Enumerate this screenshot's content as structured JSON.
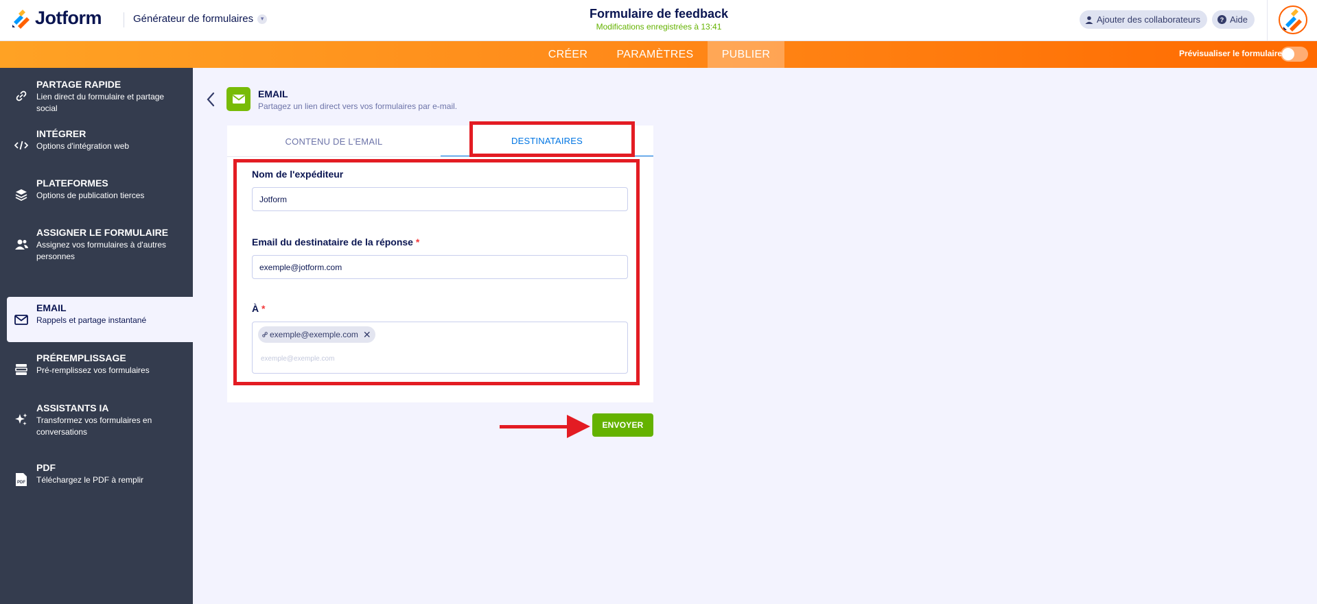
{
  "header": {
    "logo_text": "Jotform",
    "builder_label": "Générateur de formulaires",
    "form_title": "Formulaire de feedback",
    "save_status": "Modifications enregistrées à 13:41",
    "collaborators_label": "Ajouter des collaborateurs",
    "help_label": "Aide"
  },
  "nav": {
    "tabs": [
      {
        "label": "CRÉER"
      },
      {
        "label": "PARAMÈTRES"
      },
      {
        "label": "PUBLIER"
      }
    ],
    "active_tab": "PUBLIER",
    "preview_label": "Prévisualiser le formulaire",
    "preview_enabled": false
  },
  "sidebar": {
    "items": [
      {
        "title": "PARTAGE RAPIDE",
        "subtitle": "Lien direct du formulaire et partage social",
        "icon": "link-icon"
      },
      {
        "title": "INTÉGRER",
        "subtitle": "Options d'intégration web",
        "icon": "code-icon"
      },
      {
        "title": "PLATEFORMES",
        "subtitle": "Options de publication tierces",
        "icon": "layers-icon"
      },
      {
        "title": "ASSIGNER LE FORMULAIRE",
        "subtitle": "Assignez vos formulaires à d'autres personnes",
        "icon": "users-icon"
      },
      {
        "title": "EMAIL",
        "subtitle": "Rappels et partage instantané",
        "icon": "envelope-icon"
      },
      {
        "title": "PRÉREMPLISSAGE",
        "subtitle": "Pré-remplissez vos formulaires",
        "icon": "prefill-icon"
      },
      {
        "title": "ASSISTANTS IA",
        "subtitle": "Transformez vos formulaires en conversations",
        "icon": "sparkle-icon"
      },
      {
        "title": "PDF",
        "subtitle": "Téléchargez le PDF à remplir",
        "icon": "pdf-icon"
      }
    ],
    "active_item": "EMAIL"
  },
  "main": {
    "title": "EMAIL",
    "subtitle": "Partagez un lien direct vers vos formulaires par e-mail.",
    "tabs": [
      {
        "label": "CONTENU DE L'EMAIL"
      },
      {
        "label": "DESTINATAIRES"
      }
    ],
    "active_tab": "DESTINATAIRES",
    "form": {
      "sender_label": "Nom de l'expéditeur",
      "sender_value": "Jotform",
      "reply_label": "Email du destinataire de la réponse",
      "reply_value": "exemple@jotform.com",
      "to_label": "À",
      "required_mark": "*",
      "to_chip": "exemple@exemple.com",
      "to_placeholder": "exemple@exemple.com"
    },
    "send_label": "ENVOYER"
  },
  "colors": {
    "accent_orange": "#ff6100",
    "sidebar_bg": "#343c4e",
    "send_green": "#64b200",
    "tab_blue": "#0075e3",
    "annotation_red": "#e31c23"
  }
}
